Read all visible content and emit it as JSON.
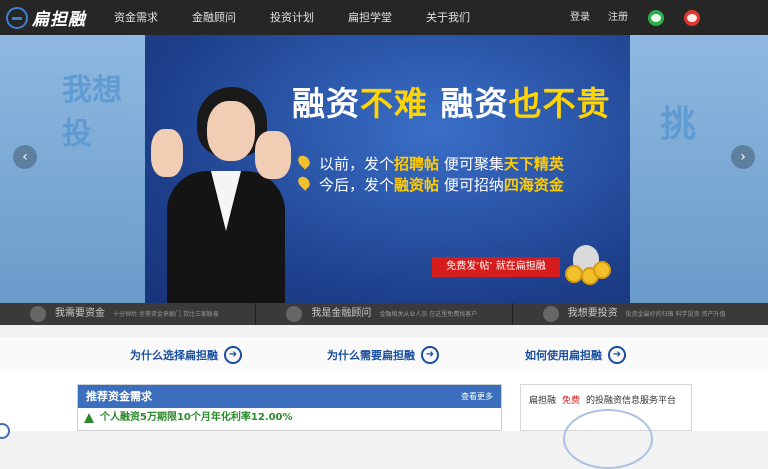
{
  "header": {
    "brand": "扁担融",
    "nav": [
      "资金需求",
      "金融顾问",
      "投资计划",
      "扁担学堂",
      "关于我们"
    ],
    "login": "登录",
    "register": "注册"
  },
  "banner": {
    "ghost_left": "我想投",
    "ghost_right": "挑",
    "headline_a": "融资",
    "headline_b": "不难",
    "headline_c": "融资",
    "headline_d": "也不贵",
    "line1_a": "以前，发个",
    "line1_b": "招聘帖",
    "line1_c": "便可聚集",
    "line1_d": "天下精英",
    "line2_a": "今后，发个",
    "line2_b": "融资帖",
    "line2_c": "便可招纳",
    "line2_d": "四海资金",
    "cta": "免费发‘帖’  就在扁担融",
    "prev": "‹",
    "next": "›"
  },
  "strip": [
    {
      "title": "我需要资金",
      "sub": "十分钟后 坐等资金来敲门 货比三家联易"
    },
    {
      "title": "我是金融顾问",
      "sub": "金融相关从业人员 在这里免费找客户"
    },
    {
      "title": "我想要投资",
      "sub": "投资金最好的归宿 科学投资 资产升值"
    }
  ],
  "why": [
    {
      "label": "为什么选择扁担融"
    },
    {
      "label": "为什么需要扁担融"
    },
    {
      "label": "如何使用扁担融"
    }
  ],
  "panel": {
    "title": "推荐资金需求",
    "more": "查看更多",
    "first_item": "个人融资5万期限10个月年化利率12.00%"
  },
  "side": {
    "brand": "扁担融",
    "free": "免费",
    "desc": "的投融资信息服务平台"
  },
  "colors": {
    "topbar": "#262626",
    "accent_blue": "#3b6fbe",
    "cta_red": "#d61c1c",
    "highlight_yellow": "#ffcc00"
  }
}
